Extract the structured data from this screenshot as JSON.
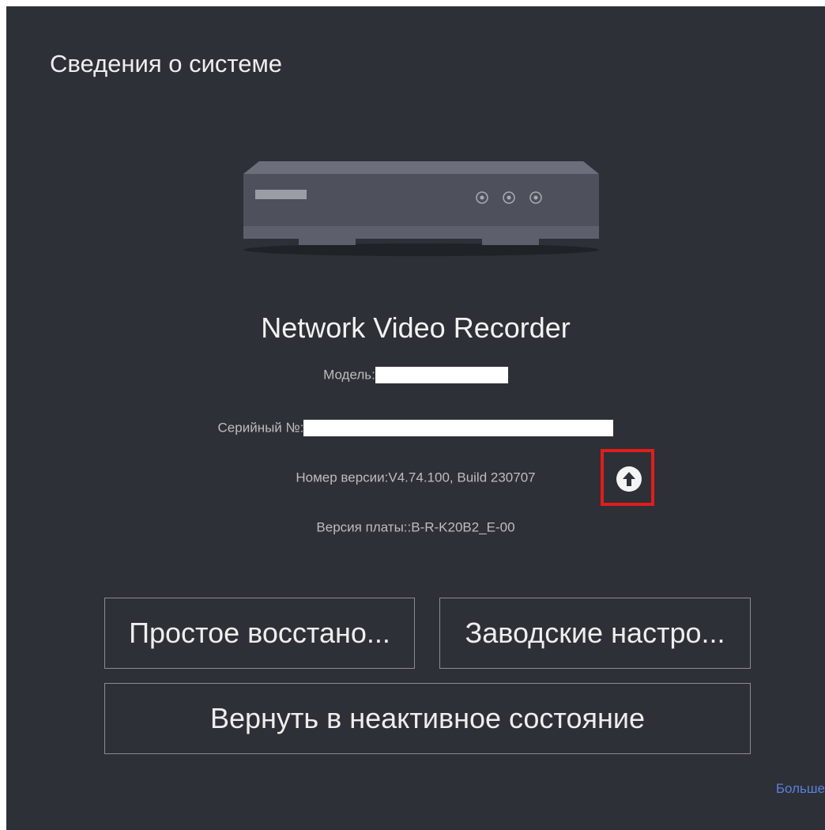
{
  "panel": {
    "title": "Сведения о системе"
  },
  "device": {
    "name": "Network Video Recorder",
    "model_label": "Модель:",
    "serial_label": "Серийный №:",
    "version_text": "Номер версии:V4.74.100, Build 230707",
    "board_text": "Версия платы::B-R-K20B2_E-00",
    "upgrade_icon": "arrow-up-circle-icon"
  },
  "actions": {
    "simple_restore": "Простое восстано...",
    "factory_defaults": "Заводские настро...",
    "restore_inactive": "Вернуть в неактивное состояние"
  },
  "links": {
    "more": "Больше"
  },
  "colors": {
    "background": "#2d3036",
    "highlight": "#e11d1d",
    "link": "#5b7fe0"
  }
}
